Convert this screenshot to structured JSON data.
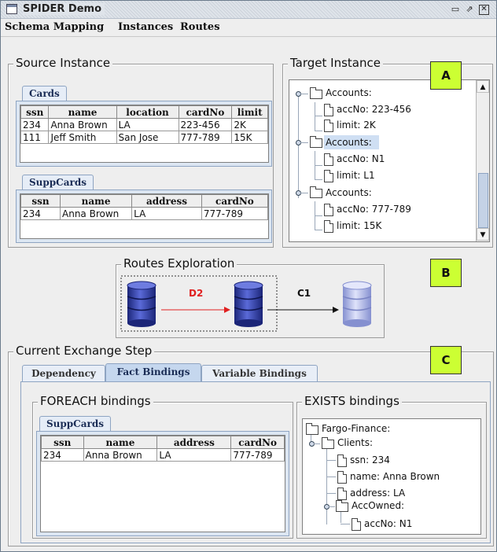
{
  "window": {
    "title": "SPIDER Demo"
  },
  "menu": [
    "Schema Mapping",
    "Instances",
    "Routes"
  ],
  "source_instance": {
    "title": "Source Instance",
    "cards": {
      "tab": "Cards",
      "columns": [
        "ssn",
        "name",
        "location",
        "cardNo",
        "limit"
      ],
      "rows": [
        [
          "234",
          "Anna Brown",
          "LA",
          "223-456",
          "2K"
        ],
        [
          "111",
          "Jeff Smith",
          "San Jose",
          "777-789",
          "15K"
        ]
      ]
    },
    "suppcards": {
      "tab": "SuppCards",
      "columns": [
        "ssn",
        "name",
        "address",
        "cardNo"
      ],
      "rows": [
        [
          "234",
          "Anna Brown",
          "LA",
          "777-789"
        ]
      ]
    }
  },
  "target_instance": {
    "title": "Target Instance",
    "tree": [
      {
        "label": "Accounts:",
        "children": [
          "accNo: 223-456",
          "limit: 2K"
        ]
      },
      {
        "label": "Accounts:",
        "children": [
          "accNo: N1",
          "limit: L1"
        ],
        "selected": true
      },
      {
        "label": "Accounts:",
        "children": [
          "accNo: 777-789",
          "limit: 15K"
        ]
      }
    ]
  },
  "routes": {
    "title": "Routes Exploration",
    "edges": [
      "D2",
      "C1"
    ],
    "colors": {
      "d2": "#e02020",
      "c1": "#111111",
      "db_active": "#3b47a8",
      "db_faded": "#aab2e0"
    }
  },
  "callouts": [
    "A",
    "B",
    "C"
  ],
  "exchange": {
    "title": "Current Exchange Step",
    "tabs": [
      "Dependency",
      "Fact Bindings",
      "Variable Bindings"
    ],
    "active_tab": "Fact Bindings",
    "foreach": {
      "title": "FOREACH bindings",
      "tab": "SuppCards",
      "columns": [
        "ssn",
        "name",
        "address",
        "cardNo"
      ],
      "rows": [
        [
          "234",
          "Anna Brown",
          "LA",
          "777-789"
        ]
      ]
    },
    "exists": {
      "title": "EXISTS bindings",
      "root": "Fargo-Finance:",
      "clients": "Clients:",
      "fields": [
        "ssn: 234",
        "name: Anna Brown",
        "address: LA"
      ],
      "accowned": "AccOwned:",
      "accno": "accNo: N1"
    }
  }
}
